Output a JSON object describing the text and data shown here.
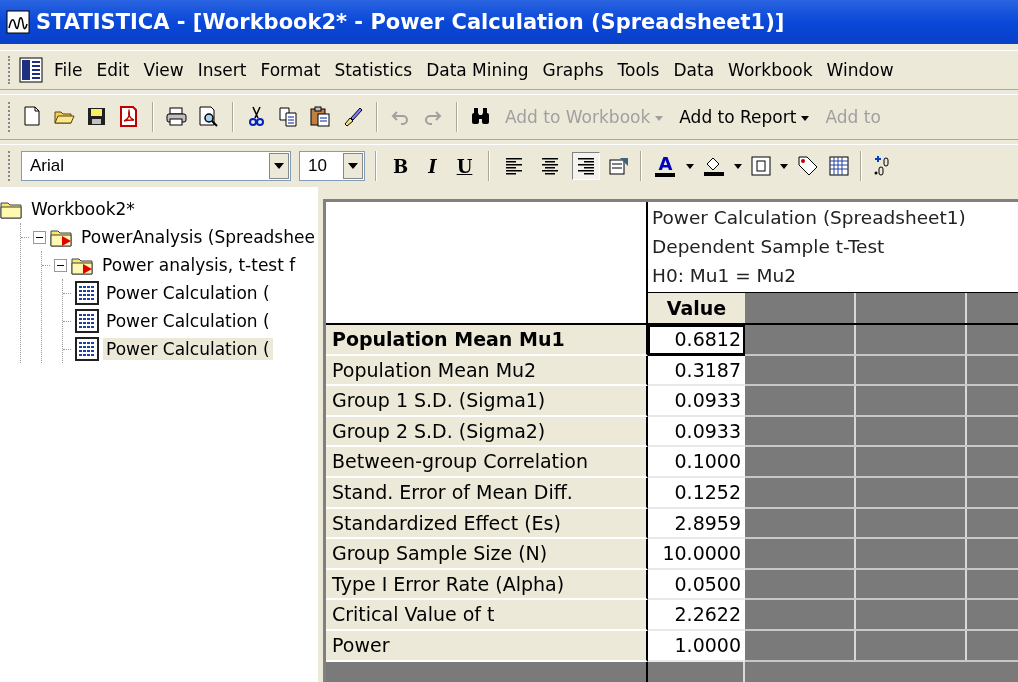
{
  "window": {
    "title": "STATISTICA - [Workbook2* - Power Calculation (Spreadsheet1)]"
  },
  "menu": [
    "File",
    "Edit",
    "View",
    "Insert",
    "Format",
    "Statistics",
    "Data Mining",
    "Graphs",
    "Tools",
    "Data",
    "Workbook",
    "Window"
  ],
  "toolbar_text_buttons": [
    {
      "label": "Add to Workbook",
      "disabled": true,
      "dropdown": true
    },
    {
      "label": "Add to Report",
      "disabled": false,
      "dropdown": true
    },
    {
      "label": "Add to",
      "disabled": true,
      "dropdown": false
    }
  ],
  "format_bar": {
    "font": "Arial",
    "size": "10",
    "style_buttons": [
      "B",
      "I",
      "U"
    ],
    "alignment": [
      {
        "selected": false
      },
      {
        "selected": false
      },
      {
        "selected": true
      }
    ],
    "font_color_label": "A"
  },
  "tree": [
    {
      "label": "Workbook2*",
      "kind": "folder",
      "selected": false,
      "children": [
        {
          "label": "PowerAnalysis (Spreadshee",
          "kind": "folder",
          "expanded": true,
          "selected": false,
          "children": [
            {
              "label": "Power analysis, t-test f",
              "kind": "folder",
              "expanded": true,
              "selected": false,
              "children": [
                {
                  "label": "Power Calculation (",
                  "kind": "sheet",
                  "selected": false
                },
                {
                  "label": "Power Calculation (",
                  "kind": "sheet",
                  "selected": false
                },
                {
                  "label": "Power Calculation (",
                  "kind": "sheet",
                  "selected": true
                }
              ]
            }
          ]
        }
      ]
    }
  ],
  "sheet": {
    "header_lines": [
      "Power Calculation (Spreadsheet1)",
      "Dependent Sample t-Test",
      "H0: Mu1 = Mu2"
    ],
    "column": "Value",
    "rows": [
      {
        "label": "Population Mean Mu1",
        "value": "0.6812",
        "selected": true
      },
      {
        "label": "Population Mean Mu2",
        "value": "0.3187",
        "selected": false
      },
      {
        "label": "Group 1 S.D. (Sigma1)",
        "value": "0.0933",
        "selected": false
      },
      {
        "label": "Group 2 S.D. (Sigma2)",
        "value": "0.0933",
        "selected": false
      },
      {
        "label": "Between-group Correlation",
        "value": "0.1000",
        "selected": false
      },
      {
        "label": "Stand. Error of Mean Diff.",
        "value": "0.1252",
        "selected": false
      },
      {
        "label": "Standardized Effect (Es)",
        "value": "2.8959",
        "selected": false
      },
      {
        "label": "Group Sample Size (N)",
        "value": "10.0000",
        "selected": false
      },
      {
        "label": "Type I Error Rate (Alpha)",
        "value": "0.0500",
        "selected": false
      },
      {
        "label": "Critical Value of t",
        "value": "2.2622",
        "selected": false
      },
      {
        "label": "Power",
        "value": "1.0000",
        "selected": false
      }
    ]
  }
}
